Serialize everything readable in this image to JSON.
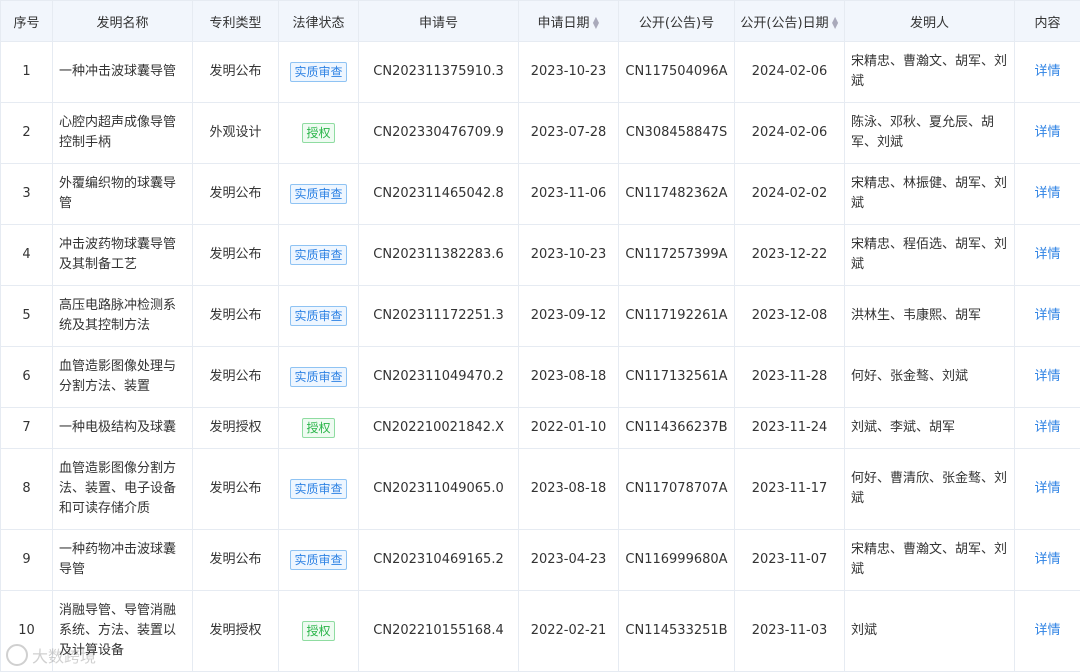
{
  "headers": [
    "序号",
    "发明名称",
    "专利类型",
    "法律状态",
    "申请号",
    "申请日期",
    "公开(公告)号",
    "公开(公告)日期",
    "发明人",
    "内容"
  ],
  "sort_icon": "sort-caret-icon",
  "colors": {
    "exam": "#2f83e4",
    "grant": "#2bb54a",
    "header_bg": "#f2f6fc",
    "link": "#2f83e4"
  },
  "rows": [
    {
      "no": "1",
      "name": "一种冲击波球囊导管",
      "type": "发明公布",
      "status": "实质审查",
      "status_kind": "exam",
      "app_no": "CN202311375910.3",
      "app_date": "2023-10-23",
      "pub_no": "CN117504096A",
      "pub_date": "2024-02-06",
      "inventors": "宋精忠、曹瀚文、胡军、刘斌",
      "detail": "详情"
    },
    {
      "no": "2",
      "name": "心腔内超声成像导管控制手柄",
      "type": "外观设计",
      "status": "授权",
      "status_kind": "grant",
      "app_no": "CN202330476709.9",
      "app_date": "2023-07-28",
      "pub_no": "CN308458847S",
      "pub_date": "2024-02-06",
      "inventors": "陈泳、邓秋、夏允辰、胡军、刘斌",
      "detail": "详情"
    },
    {
      "no": "3",
      "name": "外覆编织物的球囊导管",
      "type": "发明公布",
      "status": "实质审查",
      "status_kind": "exam",
      "app_no": "CN202311465042.8",
      "app_date": "2023-11-06",
      "pub_no": "CN117482362A",
      "pub_date": "2024-02-02",
      "inventors": "宋精忠、林振健、胡军、刘斌",
      "detail": "详情"
    },
    {
      "no": "4",
      "name": "冲击波药物球囊导管及其制备工艺",
      "type": "发明公布",
      "status": "实质审查",
      "status_kind": "exam",
      "app_no": "CN202311382283.6",
      "app_date": "2023-10-23",
      "pub_no": "CN117257399A",
      "pub_date": "2023-12-22",
      "inventors": "宋精忠、程佰选、胡军、刘斌",
      "detail": "详情"
    },
    {
      "no": "5",
      "name": "高压电路脉冲检测系统及其控制方法",
      "type": "发明公布",
      "status": "实质审查",
      "status_kind": "exam",
      "app_no": "CN202311172251.3",
      "app_date": "2023-09-12",
      "pub_no": "CN117192261A",
      "pub_date": "2023-12-08",
      "inventors": "洪林生、韦康熙、胡军",
      "detail": "详情"
    },
    {
      "no": "6",
      "name": "血管造影图像处理与分割方法、装置",
      "type": "发明公布",
      "status": "实质审查",
      "status_kind": "exam",
      "app_no": "CN202311049470.2",
      "app_date": "2023-08-18",
      "pub_no": "CN117132561A",
      "pub_date": "2023-11-28",
      "inventors": "何好、张金骜、刘斌",
      "detail": "详情"
    },
    {
      "no": "7",
      "name": "一种电极结构及球囊",
      "type": "发明授权",
      "status": "授权",
      "status_kind": "grant",
      "app_no": "CN202210021842.X",
      "app_date": "2022-01-10",
      "pub_no": "CN114366237B",
      "pub_date": "2023-11-24",
      "inventors": "刘斌、李斌、胡军",
      "detail": "详情"
    },
    {
      "no": "8",
      "name": "血管造影图像分割方法、装置、电子设备和可读存储介质",
      "type": "发明公布",
      "status": "实质审查",
      "status_kind": "exam",
      "app_no": "CN202311049065.0",
      "app_date": "2023-08-18",
      "pub_no": "CN117078707A",
      "pub_date": "2023-11-17",
      "inventors": "何好、曹清欣、张金骜、刘斌",
      "detail": "详情"
    },
    {
      "no": "9",
      "name": "一种药物冲击波球囊导管",
      "type": "发明公布",
      "status": "实质审查",
      "status_kind": "exam",
      "app_no": "CN202310469165.2",
      "app_date": "2023-04-23",
      "pub_no": "CN116999680A",
      "pub_date": "2023-11-07",
      "inventors": "宋精忠、曹瀚文、胡军、刘斌",
      "detail": "详情"
    },
    {
      "no": "10",
      "name": "消融导管、导管消融系统、方法、装置以及计算设备",
      "type": "发明授权",
      "status": "授权",
      "status_kind": "grant",
      "app_no": "CN202210155168.4",
      "app_date": "2022-02-21",
      "pub_no": "CN114533251B",
      "pub_date": "2023-11-03",
      "inventors": "刘斌",
      "detail": "详情"
    }
  ],
  "watermark": "大数跨境"
}
